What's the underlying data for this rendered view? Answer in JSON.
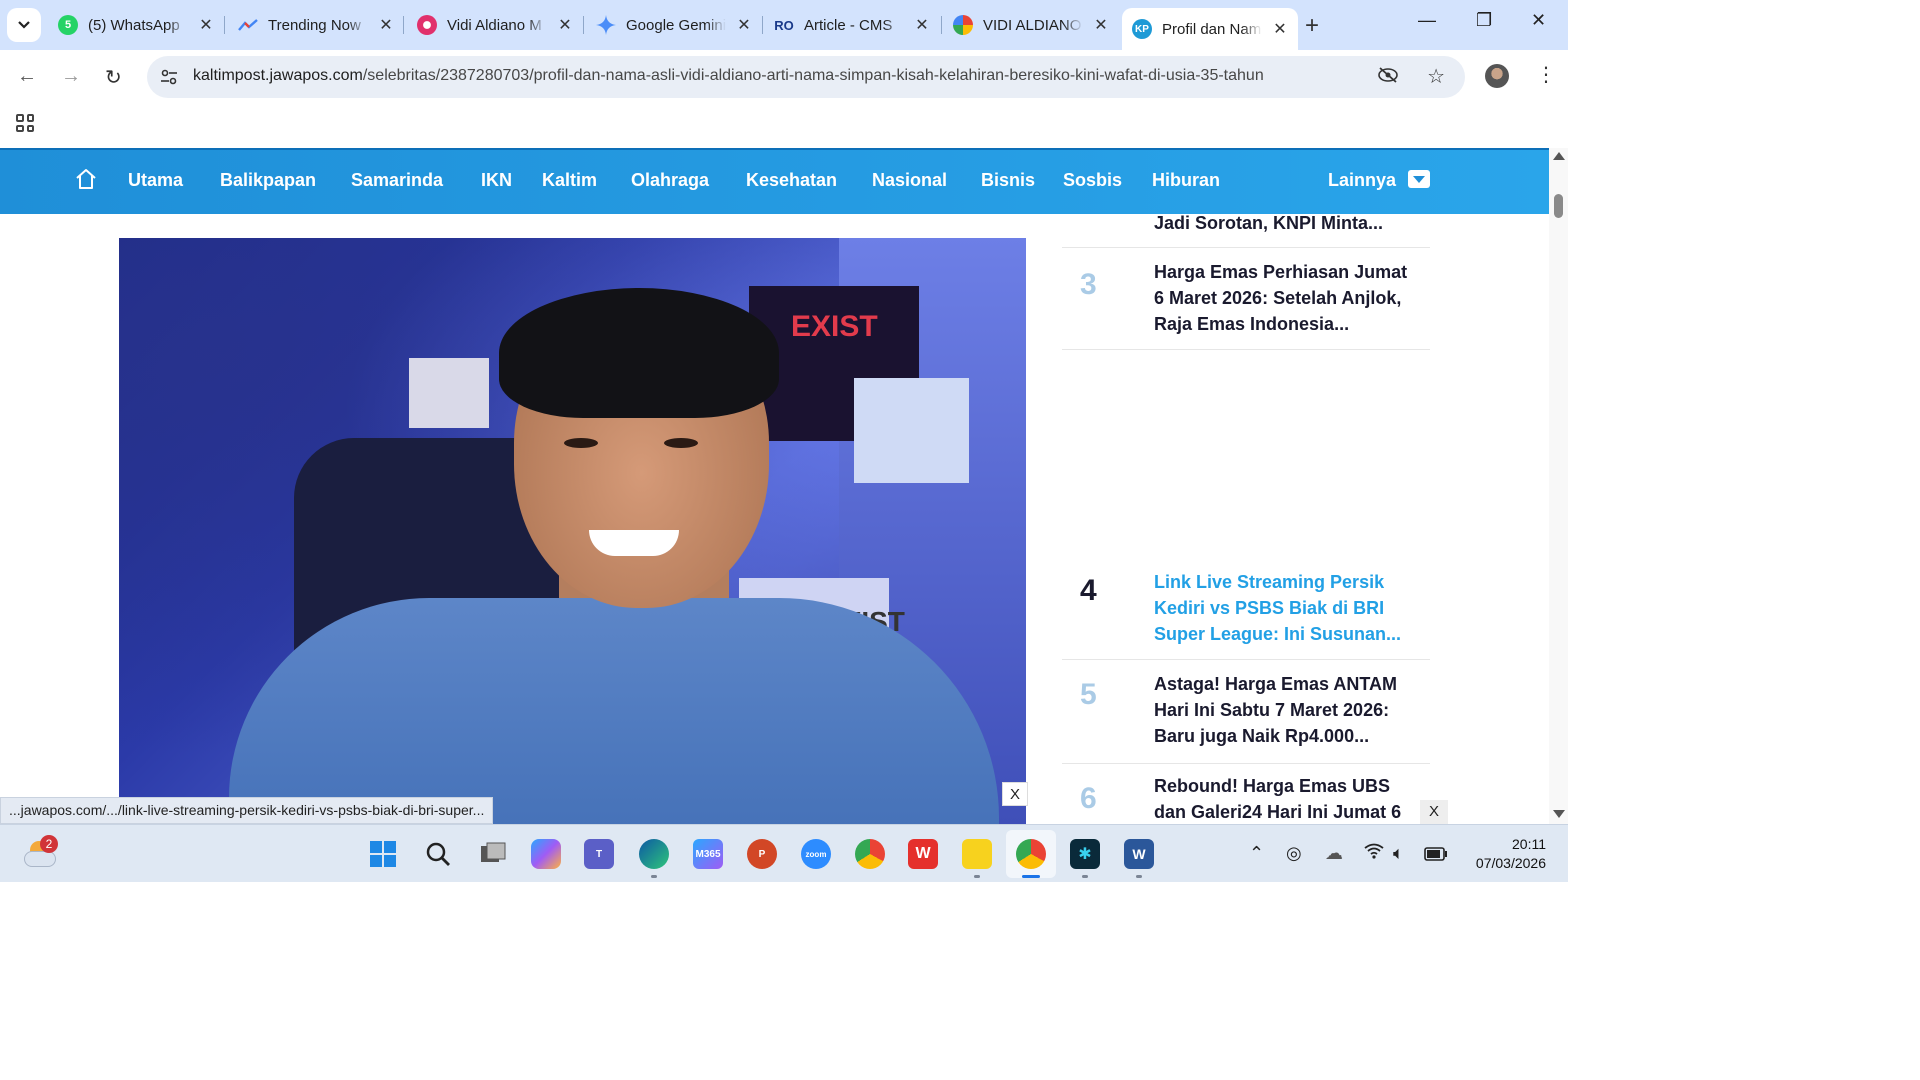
{
  "tabs": [
    {
      "title": "(5) WhatsApp",
      "icon": "whatsapp-icon",
      "color": "#25d366",
      "badge": "5"
    },
    {
      "title": "Trending Now",
      "icon": "trends-icon",
      "color": "#4285f4"
    },
    {
      "title": "Vidi Aldiano M",
      "icon": "instagram-icon",
      "color": "#e1306c"
    },
    {
      "title": "Google Gemini",
      "icon": "gemini-icon",
      "color": "#4285f4"
    },
    {
      "title": "Article - CMS",
      "icon": "cms-icon",
      "color": "#1a3a8a"
    },
    {
      "title": "VIDI ALDIANO",
      "icon": "google-icon",
      "color": "#4285f4"
    },
    {
      "title": "Profil dan Nam",
      "icon": "kp-icon",
      "color": "#1e9ad6"
    }
  ],
  "address": {
    "domain": "kaltimpost.jawapos.com",
    "path": "/selebritas/2387280703/profil-dan-nama-asli-vidi-aldiano-arti-nama-simpan-kisah-kelahiran-beresiko-kini-wafat-di-usia-35-tahun"
  },
  "site_nav": {
    "items": [
      "Utama",
      "Balikpapan",
      "Samarinda",
      "IKN",
      "Kaltim",
      "Olahraga",
      "Kesehatan",
      "Nasional",
      "Bisnis",
      "Sosbis",
      "Hiburan"
    ],
    "more": "Lainnya"
  },
  "photo": {
    "poster_text": "EXIST",
    "poster_text_2": "EXIST"
  },
  "sidebar": {
    "partial_title": "Jadi Sorotan, KNPI Minta...",
    "items": [
      {
        "num": "3",
        "title": "Harga Emas Perhiasan Jumat 6 Maret 2026: Setelah Anjlok, Raja Emas Indonesia..."
      },
      {
        "num": "4",
        "title": "Link Live Streaming Persik Kediri vs PSBS Biak di BRI Super League: Ini Susunan..."
      },
      {
        "num": "5",
        "title": "Astaga! Harga Emas ANTAM Hari Ini Sabtu 7 Maret 2026: Baru juga Naik Rp4.000..."
      },
      {
        "num": "6",
        "title": "Rebound! Harga Emas UBS dan Galeri24 Hari Ini Jumat 6"
      }
    ]
  },
  "close_label": "X",
  "status_url": "...jawapos.com/.../link-live-streaming-persik-kediri-vs-psbs-biak-di-bri-super...",
  "taskbar": {
    "weather_badge": "2",
    "time": "20:11",
    "date": "07/03/2026"
  }
}
